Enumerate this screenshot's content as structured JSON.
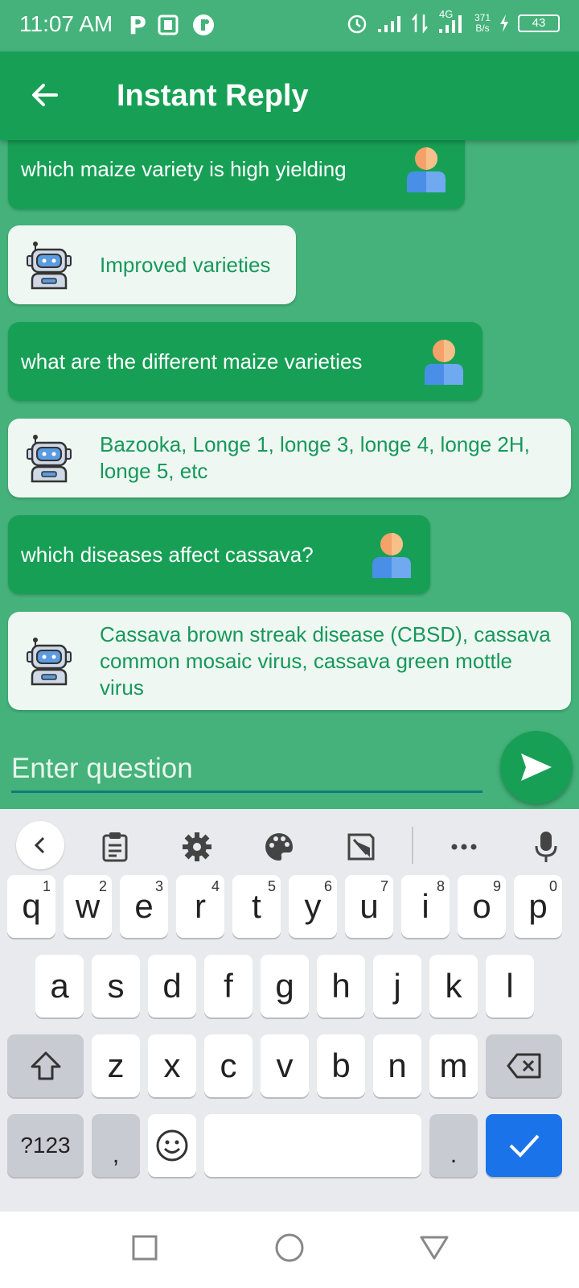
{
  "status_bar": {
    "time": "11:07 AM",
    "network_speed": "371",
    "network_unit": "B/s",
    "network_type": "4G",
    "battery": "43"
  },
  "app_bar": {
    "title": "Instant Reply",
    "back_icon": "arrow-left-icon"
  },
  "colors": {
    "background": "#44b27a",
    "app_bar": "#17a055",
    "user_bubble": "#17a055",
    "bot_bubble": "#eef7f2",
    "bot_text": "#17985a",
    "enter_key": "#1a73e8"
  },
  "messages": [
    {
      "sender": "user",
      "text": "which maize variety is high yielding"
    },
    {
      "sender": "bot",
      "text": "Improved varieties"
    },
    {
      "sender": "user",
      "text": "what are the different maize varieties"
    },
    {
      "sender": "bot",
      "text": "Bazooka, Longe 1, longe 3, longe 4, longe 2H, longe 5, etc"
    },
    {
      "sender": "user",
      "text": "which diseases affect cassava?"
    },
    {
      "sender": "bot",
      "text": "Cassava brown streak disease (CBSD), cassava common mosaic virus, cassava green mottle virus"
    }
  ],
  "input": {
    "placeholder": "Enter question",
    "send_icon": "send-icon"
  },
  "keyboard": {
    "toolbar": [
      "chevron-left-icon",
      "clipboard-icon",
      "settings-icon",
      "palette-icon",
      "resize-icon",
      "more-icon",
      "microphone-icon"
    ],
    "row1": [
      {
        "key": "q",
        "hint": "1"
      },
      {
        "key": "w",
        "hint": "2"
      },
      {
        "key": "e",
        "hint": "3"
      },
      {
        "key": "r",
        "hint": "4"
      },
      {
        "key": "t",
        "hint": "5"
      },
      {
        "key": "y",
        "hint": "6"
      },
      {
        "key": "u",
        "hint": "7"
      },
      {
        "key": "i",
        "hint": "8"
      },
      {
        "key": "o",
        "hint": "9"
      },
      {
        "key": "p",
        "hint": "0"
      }
    ],
    "row2": [
      "a",
      "s",
      "d",
      "f",
      "g",
      "h",
      "j",
      "k",
      "l"
    ],
    "row3": [
      "z",
      "x",
      "c",
      "v",
      "b",
      "n",
      "m"
    ],
    "symbols_label": "?123",
    "comma": ",",
    "period": "."
  }
}
